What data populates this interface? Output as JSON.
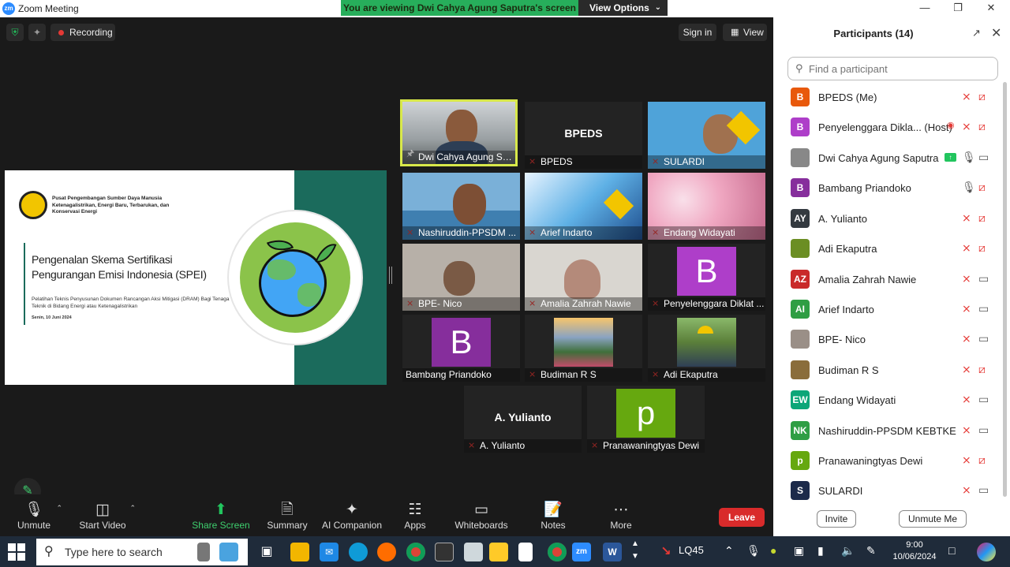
{
  "window": {
    "title": "Zoom Meeting",
    "logo_text": "zm",
    "banner": "You are viewing Dwi Cahya Agung Saputra's screen",
    "view_options": "View Options"
  },
  "top_bar": {
    "recording": "Recording",
    "sign_in": "Sign in",
    "view": "View"
  },
  "slide": {
    "org": "Pusat Pengembangan Sumber Daya Manusia Ketenagalistrikan, Energi Baru, Terbarukan, dan Konservasi Energi",
    "title": "Pengenalan Skema Sertifikasi Pengurangan Emisi Indonesia (SPEI)",
    "subtitle": "Pelatihan Teknis Penyusunan Dokumen Rancangan Aksi Mitigasi (DRAM) Bagi Tenaga Teknik di Bidang Energi atau Ketenagalistrikan",
    "date": "Senin, 10 Juni 2024"
  },
  "tiles": [
    {
      "name": "Dwi Cahya Agung Sa...",
      "kind": "video"
    },
    {
      "name": "BPEDS",
      "center": "BPEDS",
      "kind": "name"
    },
    {
      "name": "SULARDI",
      "kind": "video"
    },
    {
      "name": "Nashiruddin-PPSDM ...",
      "kind": "video"
    },
    {
      "name": "Arief Indarto",
      "kind": "video"
    },
    {
      "name": "Endang Widayati",
      "kind": "video"
    },
    {
      "name": "BPE- Nico",
      "kind": "video"
    },
    {
      "name": "Amalia Zahrah Nawie",
      "kind": "video"
    },
    {
      "name": "Penyelenggara Diklat ...",
      "letter": "B",
      "kind": "avatar"
    },
    {
      "name": "Bambang Priandoko",
      "letter": "B",
      "kind": "avatar"
    },
    {
      "name": "Budiman R S",
      "kind": "video"
    },
    {
      "name": "Adi Ekaputra",
      "kind": "video"
    },
    {
      "name": "A. Yulianto",
      "center": "A. Yulianto",
      "kind": "name"
    },
    {
      "name": "Pranawaningtyas Dewi",
      "letter": "p",
      "kind": "avatar"
    }
  ],
  "toolbar": {
    "unmute": "Unmute",
    "start_video": "Start Video",
    "share_screen": "Share Screen",
    "summary": "Summary",
    "ai_companion": "AI Companion",
    "apps": "Apps",
    "whiteboards": "Whiteboards",
    "notes": "Notes",
    "more": "More",
    "leave": "Leave"
  },
  "participants": {
    "title": "Participants (14)",
    "search_placeholder": "Find a participant",
    "invite": "Invite",
    "unmute_me": "Unmute Me",
    "list": [
      {
        "initials": "B",
        "name": "BPEDS (Me)",
        "color": "#e8590c",
        "mic": "muted",
        "cam": "off"
      },
      {
        "initials": "B",
        "name": "Penyelenggara Dikla... (Host)",
        "color": "#ae3ec9",
        "mic": "muted",
        "cam": "off",
        "recording": true
      },
      {
        "initials": "",
        "name": "Dwi Cahya Agung Saputra",
        "color": "#888888",
        "mic": "on",
        "cam": "on",
        "sharing": true
      },
      {
        "initials": "B",
        "name": "Bambang Priandoko",
        "color": "#862e9c",
        "mic": "on",
        "cam": "off"
      },
      {
        "initials": "AY",
        "name": "A. Yulianto",
        "color": "#343a40",
        "mic": "muted",
        "cam": "off"
      },
      {
        "initials": "",
        "name": "Adi Ekaputra",
        "color": "#6b8e23",
        "mic": "muted",
        "cam": "off"
      },
      {
        "initials": "AZ",
        "name": "Amalia Zahrah Nawie",
        "color": "#c92a2a",
        "mic": "muted",
        "cam": "on"
      },
      {
        "initials": "AI",
        "name": "Arief Indarto",
        "color": "#2f9e44",
        "mic": "muted",
        "cam": "on"
      },
      {
        "initials": "",
        "name": "BPE- Nico",
        "color": "#9a8f87",
        "mic": "muted",
        "cam": "on"
      },
      {
        "initials": "",
        "name": "Budiman R S",
        "color": "#8a6d3b",
        "mic": "muted",
        "cam": "off"
      },
      {
        "initials": "EW",
        "name": "Endang Widayati",
        "color": "#0ca678",
        "mic": "muted",
        "cam": "on"
      },
      {
        "initials": "NK",
        "name": "Nashiruddin-PPSDM KEBTKE",
        "color": "#2f9e44",
        "mic": "muted",
        "cam": "on"
      },
      {
        "initials": "p",
        "name": "Pranawaningtyas Dewi",
        "color": "#66a80f",
        "mic": "muted",
        "cam": "off"
      },
      {
        "initials": "S",
        "name": "SULARDI",
        "color": "#1c2a4a",
        "mic": "muted",
        "cam": "on"
      }
    ]
  },
  "taskbar": {
    "search_placeholder": "Type here to search",
    "weather": "LQ45",
    "time": "9:00",
    "date": "10/06/2024"
  }
}
